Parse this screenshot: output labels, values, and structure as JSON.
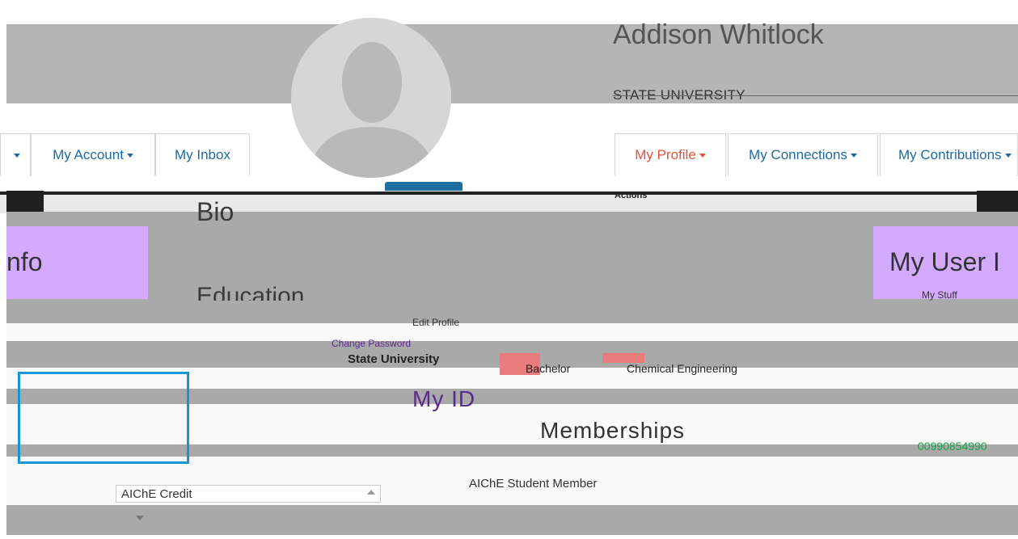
{
  "profile": {
    "name": "Addison Whitlock",
    "organization": "STATE UNIVERSITY"
  },
  "nav": {
    "left_tabs": [
      {
        "label": "My Account",
        "has_caret": true
      },
      {
        "label": "My Inbox",
        "has_caret": false
      }
    ],
    "right_tabs": [
      {
        "label": "My Profile",
        "has_caret": true,
        "active": true
      },
      {
        "label": "My Connections",
        "has_caret": true
      },
      {
        "label": "My Contributions",
        "has_caret": true
      }
    ]
  },
  "toolbar": {
    "actions_label": "Actions"
  },
  "sections": {
    "bio_heading": "Bio",
    "education_heading": "Education",
    "left_panel_title": "nfo",
    "right_panel_title": "My User I",
    "right_panel_item": "My Stuff",
    "edit_profile_link": "Edit Profile",
    "change_password_link": "Change Password",
    "myid_heading": "My ID",
    "memberships_heading": "Memberships"
  },
  "education": {
    "school": "State University",
    "degree": "Bachelor",
    "major": "Chemical Engineering"
  },
  "memberships": {
    "items": [
      "AIChE Student Member"
    ],
    "id_number": "00990854990"
  },
  "form": {
    "dropdown_value": "AIChE Credit"
  },
  "colors": {
    "accent": "#1e6aa4",
    "active_tab": "#e0533a",
    "highlight_purple": "#d4aaff",
    "highlight_red": "#e87c7c",
    "selection_frame": "#1597d4"
  }
}
